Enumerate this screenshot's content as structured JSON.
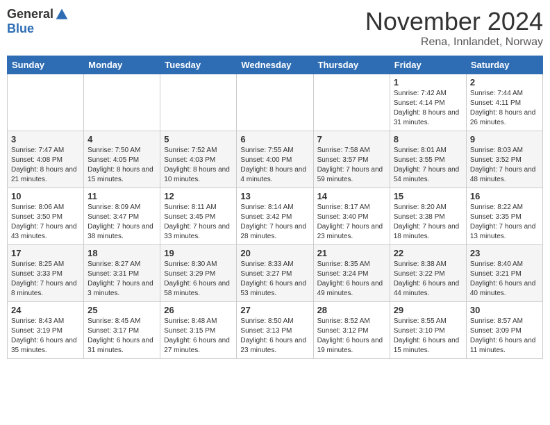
{
  "logo": {
    "general": "General",
    "blue": "Blue"
  },
  "title": "November 2024",
  "location": "Rena, Innlandet, Norway",
  "days_of_week": [
    "Sunday",
    "Monday",
    "Tuesday",
    "Wednesday",
    "Thursday",
    "Friday",
    "Saturday"
  ],
  "weeks": [
    [
      {
        "day": "",
        "info": ""
      },
      {
        "day": "",
        "info": ""
      },
      {
        "day": "",
        "info": ""
      },
      {
        "day": "",
        "info": ""
      },
      {
        "day": "",
        "info": ""
      },
      {
        "day": "1",
        "info": "Sunrise: 7:42 AM\nSunset: 4:14 PM\nDaylight: 8 hours and 31 minutes."
      },
      {
        "day": "2",
        "info": "Sunrise: 7:44 AM\nSunset: 4:11 PM\nDaylight: 8 hours and 26 minutes."
      }
    ],
    [
      {
        "day": "3",
        "info": "Sunrise: 7:47 AM\nSunset: 4:08 PM\nDaylight: 8 hours and 21 minutes."
      },
      {
        "day": "4",
        "info": "Sunrise: 7:50 AM\nSunset: 4:05 PM\nDaylight: 8 hours and 15 minutes."
      },
      {
        "day": "5",
        "info": "Sunrise: 7:52 AM\nSunset: 4:03 PM\nDaylight: 8 hours and 10 minutes."
      },
      {
        "day": "6",
        "info": "Sunrise: 7:55 AM\nSunset: 4:00 PM\nDaylight: 8 hours and 4 minutes."
      },
      {
        "day": "7",
        "info": "Sunrise: 7:58 AM\nSunset: 3:57 PM\nDaylight: 7 hours and 59 minutes."
      },
      {
        "day": "8",
        "info": "Sunrise: 8:01 AM\nSunset: 3:55 PM\nDaylight: 7 hours and 54 minutes."
      },
      {
        "day": "9",
        "info": "Sunrise: 8:03 AM\nSunset: 3:52 PM\nDaylight: 7 hours and 48 minutes."
      }
    ],
    [
      {
        "day": "10",
        "info": "Sunrise: 8:06 AM\nSunset: 3:50 PM\nDaylight: 7 hours and 43 minutes."
      },
      {
        "day": "11",
        "info": "Sunrise: 8:09 AM\nSunset: 3:47 PM\nDaylight: 7 hours and 38 minutes."
      },
      {
        "day": "12",
        "info": "Sunrise: 8:11 AM\nSunset: 3:45 PM\nDaylight: 7 hours and 33 minutes."
      },
      {
        "day": "13",
        "info": "Sunrise: 8:14 AM\nSunset: 3:42 PM\nDaylight: 7 hours and 28 minutes."
      },
      {
        "day": "14",
        "info": "Sunrise: 8:17 AM\nSunset: 3:40 PM\nDaylight: 7 hours and 23 minutes."
      },
      {
        "day": "15",
        "info": "Sunrise: 8:20 AM\nSunset: 3:38 PM\nDaylight: 7 hours and 18 minutes."
      },
      {
        "day": "16",
        "info": "Sunrise: 8:22 AM\nSunset: 3:35 PM\nDaylight: 7 hours and 13 minutes."
      }
    ],
    [
      {
        "day": "17",
        "info": "Sunrise: 8:25 AM\nSunset: 3:33 PM\nDaylight: 7 hours and 8 minutes."
      },
      {
        "day": "18",
        "info": "Sunrise: 8:27 AM\nSunset: 3:31 PM\nDaylight: 7 hours and 3 minutes."
      },
      {
        "day": "19",
        "info": "Sunrise: 8:30 AM\nSunset: 3:29 PM\nDaylight: 6 hours and 58 minutes."
      },
      {
        "day": "20",
        "info": "Sunrise: 8:33 AM\nSunset: 3:27 PM\nDaylight: 6 hours and 53 minutes."
      },
      {
        "day": "21",
        "info": "Sunrise: 8:35 AM\nSunset: 3:24 PM\nDaylight: 6 hours and 49 minutes."
      },
      {
        "day": "22",
        "info": "Sunrise: 8:38 AM\nSunset: 3:22 PM\nDaylight: 6 hours and 44 minutes."
      },
      {
        "day": "23",
        "info": "Sunrise: 8:40 AM\nSunset: 3:21 PM\nDaylight: 6 hours and 40 minutes."
      }
    ],
    [
      {
        "day": "24",
        "info": "Sunrise: 8:43 AM\nSunset: 3:19 PM\nDaylight: 6 hours and 35 minutes."
      },
      {
        "day": "25",
        "info": "Sunrise: 8:45 AM\nSunset: 3:17 PM\nDaylight: 6 hours and 31 minutes."
      },
      {
        "day": "26",
        "info": "Sunrise: 8:48 AM\nSunset: 3:15 PM\nDaylight: 6 hours and 27 minutes."
      },
      {
        "day": "27",
        "info": "Sunrise: 8:50 AM\nSunset: 3:13 PM\nDaylight: 6 hours and 23 minutes."
      },
      {
        "day": "28",
        "info": "Sunrise: 8:52 AM\nSunset: 3:12 PM\nDaylight: 6 hours and 19 minutes."
      },
      {
        "day": "29",
        "info": "Sunrise: 8:55 AM\nSunset: 3:10 PM\nDaylight: 6 hours and 15 minutes."
      },
      {
        "day": "30",
        "info": "Sunrise: 8:57 AM\nSunset: 3:09 PM\nDaylight: 6 hours and 11 minutes."
      }
    ]
  ]
}
